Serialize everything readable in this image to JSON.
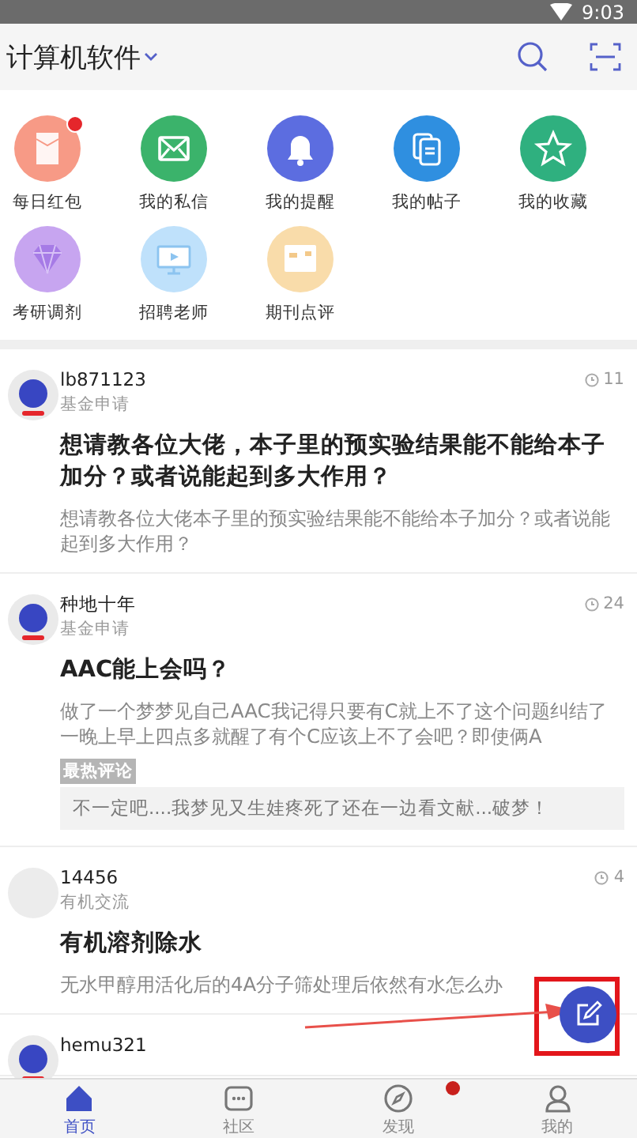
{
  "status_bar": {
    "time": "9:03"
  },
  "header": {
    "title": "计算机软件"
  },
  "shortcuts": [
    {
      "label": "每日红包",
      "kind": "envelope-yen",
      "color": "#f79a86",
      "badge": true
    },
    {
      "label": "我的私信",
      "kind": "mail",
      "color": "#3bb36b",
      "badge": false
    },
    {
      "label": "我的提醒",
      "kind": "bell",
      "color": "#5c6de0",
      "badge": false
    },
    {
      "label": "我的帖子",
      "kind": "document",
      "color": "#2f8fe0",
      "badge": false
    },
    {
      "label": "我的收藏",
      "kind": "star",
      "color": "#2fb07f",
      "badge": false
    },
    {
      "label": "考研调剂",
      "kind": "diamond",
      "color": "#c7a5f0",
      "badge": false
    },
    {
      "label": "招聘老师",
      "kind": "monitor",
      "color": "#bfe1fb",
      "badge": false
    },
    {
      "label": "期刊点评",
      "kind": "card",
      "color": "#f9dcaa",
      "badge": false
    }
  ],
  "posts": [
    {
      "author": "lb871123",
      "category": "基金申请",
      "views": "11",
      "kind": "globe",
      "title": "想请教各位大佬，本子里的预实验结果能不能给本子加分？或者说能起到多大作用？",
      "body": "想请教各位大佬本子里的预实验结果能不能给本子加分？或者说能起到多大作用？"
    },
    {
      "author": "种地十年",
      "category": "基金申请",
      "views": "24",
      "kind": "globe",
      "title": "AAC能上会吗？",
      "body": "做了一个梦梦见自己AAC我记得只要有C就上不了这个问题纠结了一晚上早上四点多就醒了有个C应该上不了会吧？即使俩A",
      "hot_comment": {
        "label": "最热评论",
        "text": "不一定吧....我梦见又生娃疼死了还在一边看文献...破梦！"
      }
    },
    {
      "author": "14456",
      "category": "有机交流",
      "views": "4",
      "kind": "plain",
      "title": "有机溶剂除水",
      "body": "无水甲醇用活化后的4A分子筛处理后依然有水怎么办"
    },
    {
      "author": "hemu321",
      "kind": "globe"
    }
  ],
  "nav": [
    {
      "label": "首页",
      "kind": "home",
      "selected": true,
      "badge": false
    },
    {
      "label": "社区",
      "kind": "chat",
      "selected": false,
      "badge": false
    },
    {
      "label": "发现",
      "kind": "compass",
      "selected": false,
      "badge": true
    },
    {
      "label": "我的",
      "kind": "person",
      "selected": false,
      "badge": false
    }
  ]
}
